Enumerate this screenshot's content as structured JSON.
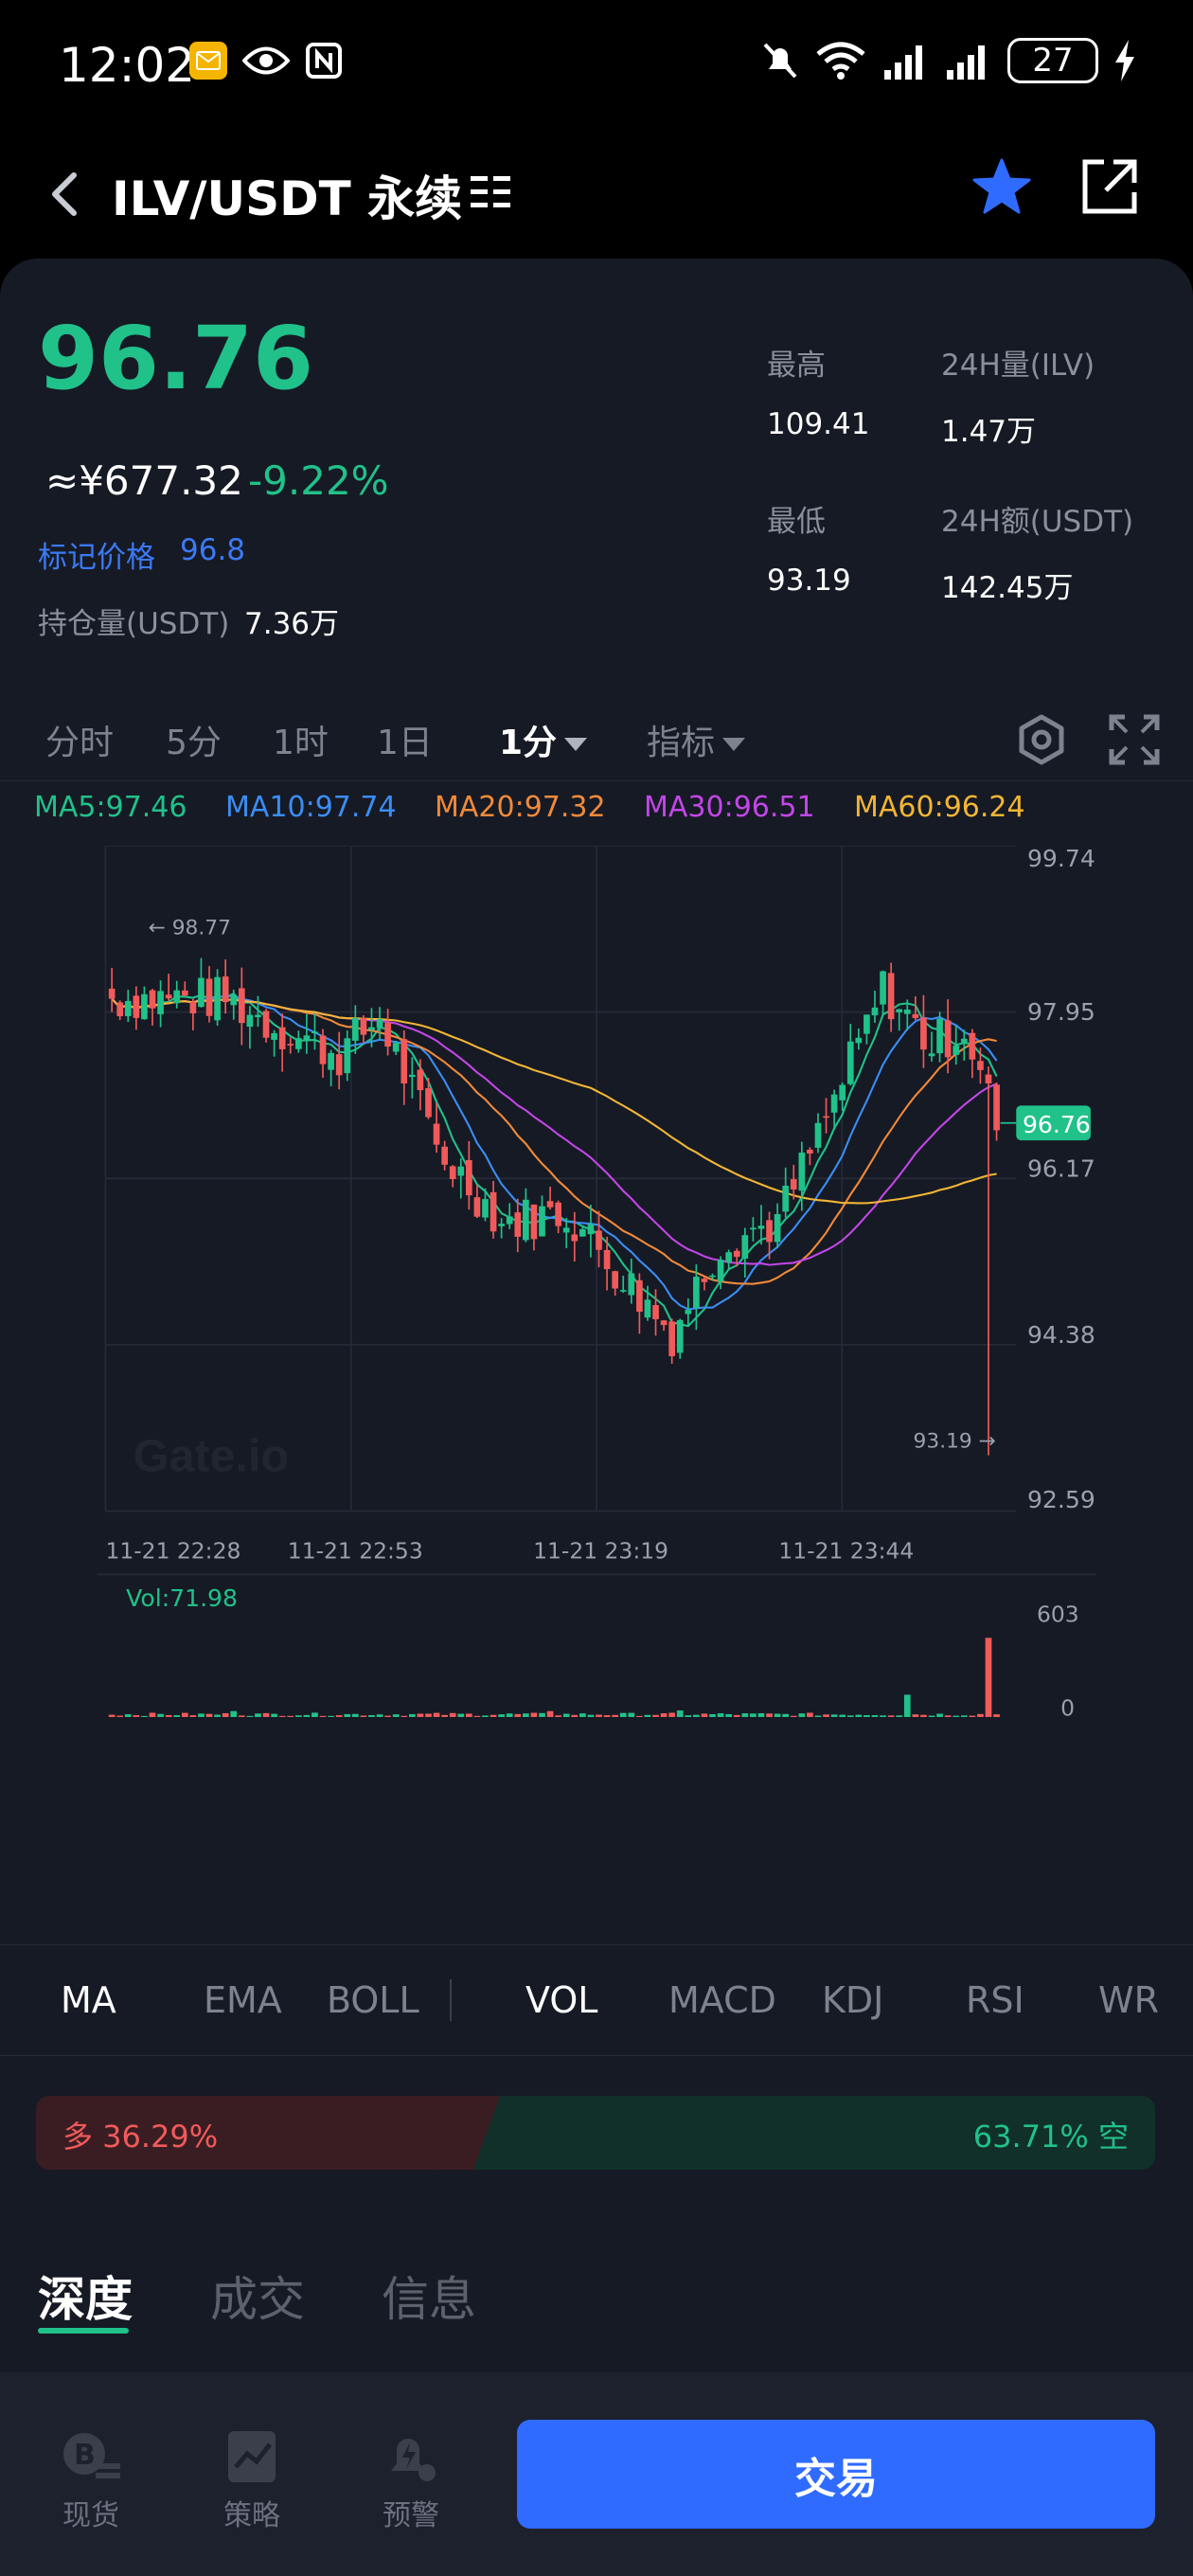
{
  "status_bar": {
    "time": "12:02",
    "battery": "27"
  },
  "header": {
    "title": "ILV/USDT 永续"
  },
  "ticker": {
    "price": "96.76",
    "cny": "≈¥677.32",
    "change": "-9.22%",
    "mark_label": "标记价格",
    "mark_value": "96.8",
    "oi_label": "持仓量(USDT)",
    "oi_value": "7.36万",
    "high_label": "最高",
    "high_value": "109.41",
    "low_label": "最低",
    "low_value": "93.19",
    "vol_label": "24H量(ILV)",
    "vol_value": "1.47万",
    "amt_label": "24H额(USDT)",
    "amt_value": "142.45万"
  },
  "period_tabs": [
    "分时",
    "5分",
    "1时",
    "1日",
    "1分",
    "指标"
  ],
  "ma_legend": [
    {
      "text": "MA5:97.46",
      "color": "#21c18a"
    },
    {
      "text": "MA10:97.74",
      "color": "#3b8df5"
    },
    {
      "text": "MA20:97.32",
      "color": "#f08a3a"
    },
    {
      "text": "MA30:96.51",
      "color": "#c246e8"
    },
    {
      "text": "MA60:96.24",
      "color": "#f2b535"
    }
  ],
  "chart": {
    "watermark": "Gate.io",
    "price_axis": [
      "99.74",
      "97.95",
      "96.17",
      "94.38",
      "92.59"
    ],
    "current_price_tag": "96.76",
    "high_marker": "← 98.77",
    "low_marker": "93.19 →",
    "time_axis": [
      "11-21 22:28",
      "11-21 22:53",
      "11-21 23:19",
      "11-21 23:44"
    ],
    "vol_label": "Vol:71.98",
    "vol_axis": [
      "603",
      "0"
    ]
  },
  "indicator_tabs": [
    "MA",
    "EMA",
    "BOLL",
    "VOL",
    "MACD",
    "KDJ",
    "RSI",
    "WR"
  ],
  "long_short": {
    "long_text": "多 36.29%",
    "short_text": "63.71% 空",
    "long_pct": 36.29
  },
  "bottom_tabs": [
    "深度",
    "成交",
    "信息"
  ],
  "bottom_nav": {
    "spot": "现货",
    "strategy": "策略",
    "alert": "预警",
    "trade": "交易"
  },
  "chart_data": {
    "type": "candlestick",
    "title": "",
    "ylim": [
      92.59,
      99.74
    ],
    "x": [
      "11-21 22:28",
      "11-21 22:53",
      "11-21 23:19",
      "11-21 23:44"
    ],
    "series": [
      {
        "name": "MA5",
        "value": 97.46
      },
      {
        "name": "MA10",
        "value": 97.74
      },
      {
        "name": "MA20",
        "value": 97.32
      },
      {
        "name": "MA30",
        "value": 96.51
      },
      {
        "name": "MA60",
        "value": 96.24
      }
    ],
    "last": 96.76,
    "high": 98.77,
    "low": 93.19,
    "volume_max": 603,
    "volume_last": 71.98
  }
}
